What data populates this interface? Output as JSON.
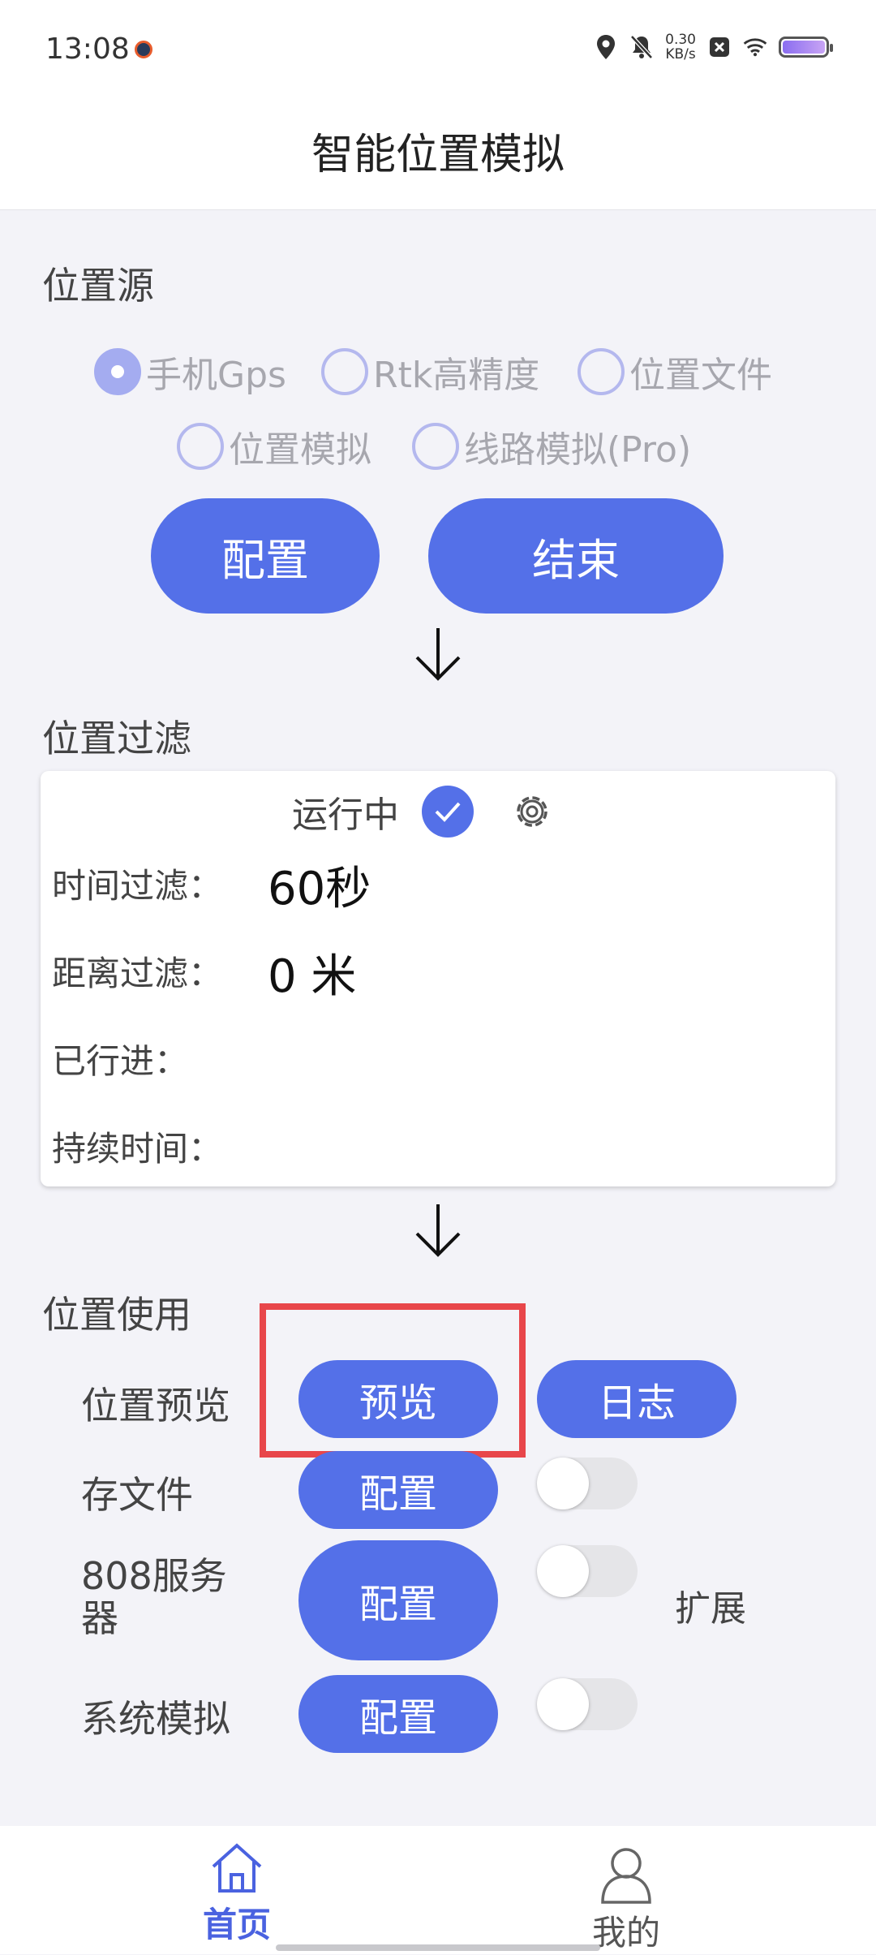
{
  "status_bar": {
    "time": "13:08",
    "net_speed_value": "0.30",
    "net_speed_unit": "KB/s",
    "icons": [
      "location-icon",
      "bell-off-icon",
      "close-box-icon",
      "wifi-icon",
      "battery-icon"
    ]
  },
  "app": {
    "title": "智能位置模拟"
  },
  "source": {
    "title": "位置源",
    "options": [
      {
        "label": "手机Gps",
        "checked": true
      },
      {
        "label": "Rtk高精度",
        "checked": false
      },
      {
        "label": "位置文件",
        "checked": false
      },
      {
        "label": "位置模拟",
        "checked": false
      },
      {
        "label": "线路模拟(Pro)",
        "checked": false
      }
    ],
    "config_label": "配置",
    "end_label": "结束"
  },
  "filter": {
    "title": "位置过滤",
    "status_text": "运行中",
    "time_label": "时间过滤：",
    "time_value": "60秒",
    "distance_label": "距离过滤：",
    "distance_value": "0 米",
    "traveled_label": "已行进：",
    "duration_label": "持续时间："
  },
  "usage": {
    "title": "位置使用",
    "preview_label": "位置预览",
    "preview_button": "预览",
    "log_button": "日志",
    "save_file_label": "存文件",
    "save_file_button": "配置",
    "server_label_line1": "808服务",
    "server_label_line2": "器",
    "server_button": "配置",
    "extend_label": "扩展",
    "system_label": "系统模拟",
    "system_button": "配置",
    "toggles": {
      "save_file": false,
      "server": false,
      "system": false
    }
  },
  "accent_color": "#5470e8",
  "highlight_color": "#e8464a",
  "nav": {
    "home_label": "首页",
    "mine_label": "我的",
    "active": "home"
  }
}
